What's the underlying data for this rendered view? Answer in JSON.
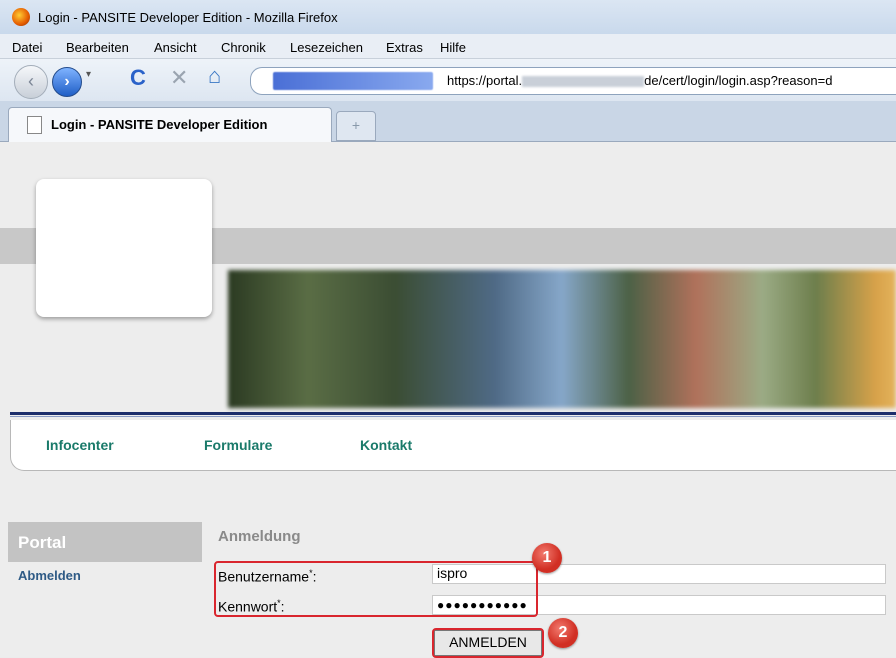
{
  "window": {
    "title": "Login - PANSITE Developer Edition - Mozilla Firefox"
  },
  "menu": [
    "Datei",
    "Bearbeiten",
    "Ansicht",
    "Chronik",
    "Lesezeichen",
    "Extras",
    "Hilfe"
  ],
  "navbar": {
    "forward_glyph": "›",
    "back_glyph": "‹",
    "reload_glyph": "C",
    "stop_glyph": "✕",
    "home_glyph": "⌂",
    "url_prefix": "https://portal.",
    "url_suffix": "de/cert/login/login.asp?reason=d"
  },
  "tab": {
    "label": "Login - PANSITE Developer Edition",
    "new_tab_glyph": "+"
  },
  "site_nav": [
    "Infocenter",
    "Formulare",
    "Kontakt"
  ],
  "sidebar": {
    "heading": "Portal",
    "link": "Abmelden"
  },
  "login": {
    "heading": "Anmeldung",
    "username_label": "Benutzername",
    "password_label": "Kennwort",
    "required_marker": "*",
    "label_suffix": ":",
    "username_value": "ispro",
    "password_value": "●●●●●●●●●●●",
    "submit_label": "ANMELDEN"
  },
  "annotations": {
    "badge1": "1",
    "badge2": "2",
    "color": "#d9262e"
  },
  "icons": [
    "firefox-logo-icon",
    "back-arrow-icon",
    "forward-arrow-icon",
    "reload-icon",
    "stop-icon",
    "home-icon",
    "page-icon",
    "new-tab-icon"
  ]
}
